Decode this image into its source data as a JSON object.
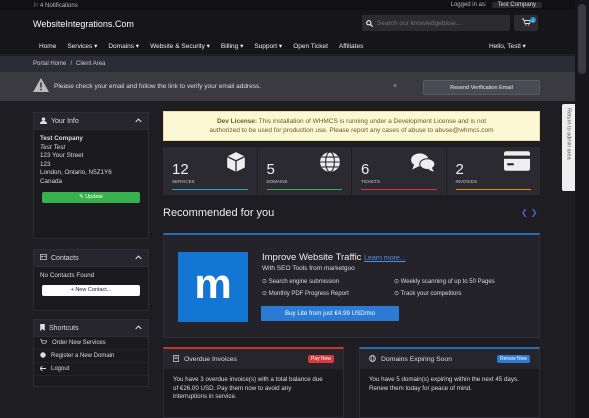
{
  "topbar": {
    "notifications": "4 Notifications",
    "logged_in_as": "Logged in as:",
    "company": "Test Company"
  },
  "header": {
    "logo": "WebsiteIntegrations.Com",
    "search_placeholder": "Search our knowledgebase...",
    "cart_count": "0"
  },
  "nav": {
    "items": [
      "Home",
      "Services ▾",
      "Domains ▾",
      "Website & Security ▾",
      "Billing ▾",
      "Support ▾",
      "Open Ticket",
      "Affiliates"
    ],
    "user": "Hello, Testl ▾"
  },
  "breadcrumb": {
    "home": "Portal Home",
    "sep": "/",
    "current": "Client Area"
  },
  "alert": {
    "text": "Please check your email and follow the link to verify your email address.",
    "resend": "Resend Verification Email",
    "close": "×"
  },
  "your_info": {
    "title": "Your Info",
    "company": "Test Company",
    "name": "Test Test",
    "address1": "123 Your Street",
    "address2": "123",
    "city": "London, Ontario, N5Z1Y6",
    "country": "Canada",
    "update": "✎ Update"
  },
  "contacts": {
    "title": "Contacts",
    "none": "No Contacts Found",
    "new": "+ New Contact..."
  },
  "shortcuts": {
    "title": "Shortcuts",
    "items": [
      "Order New Services",
      "Register a New Domain",
      "Logout"
    ]
  },
  "dev_license": {
    "label": "Dev License:",
    "line1": "This installation of WHMCS is running under a Development License and is not",
    "line2": "authorized to be used for production use. Please report any cases of abuse to abuse@whmcs.com"
  },
  "stats": [
    {
      "num": "12",
      "label": "SERVICES",
      "color": "#2aa9c9"
    },
    {
      "num": "5",
      "label": "DOMAINS",
      "color": "#37b24d"
    },
    {
      "num": "6",
      "label": "TICKETS",
      "color": "#e03131"
    },
    {
      "num": "2",
      "label": "INVOICES",
      "color": "#f08c00"
    }
  ],
  "recommended": {
    "title": "Recommended for you",
    "arrows": "❮❯"
  },
  "promo": {
    "logo_letter": "m",
    "title": "Improve Website Traffic",
    "learn": "Learn more...",
    "subtitle": "With SEO Tools from marketgoo",
    "features": [
      "Search engine submission",
      "Weekly scanning of up to 50 Pages",
      "Monthly PDF Progress Report",
      "Track your competitors"
    ],
    "buy": "Buy Lite from just €4.99 USD/mo"
  },
  "overdue": {
    "title": "Overdue Invoices",
    "action": "Pay Now",
    "text1": "You have 3 overdue invoice(s) with a total balance due",
    "text2": "of €26.00 USD. Pay them now to avoid any",
    "text3": "interruptions in service."
  },
  "expiring": {
    "title": "Domains Expiring Soon",
    "action": "Renew Now",
    "text1": "You have 5 domain(s) expiring within the next 45 days.",
    "text2": "Renew them today for peace of mind."
  },
  "sidetab": {
    "label": "Return to admin area"
  }
}
